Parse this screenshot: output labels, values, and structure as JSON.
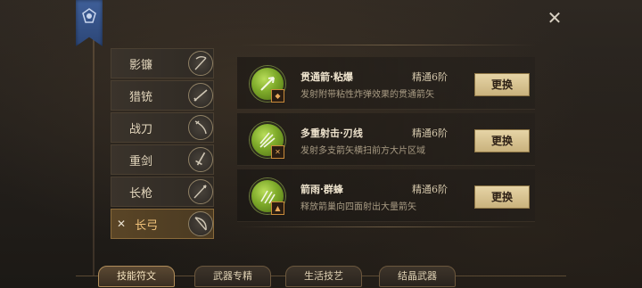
{
  "close_icon": "close-icon",
  "weapons": [
    {
      "label": "影镰",
      "icon": "scythe-icon",
      "selected": false
    },
    {
      "label": "猎铳",
      "icon": "musket-icon",
      "selected": false
    },
    {
      "label": "战刀",
      "icon": "sabre-icon",
      "selected": false
    },
    {
      "label": "重剑",
      "icon": "greatsword-icon",
      "selected": false
    },
    {
      "label": "长枪",
      "icon": "spear-icon",
      "selected": false
    },
    {
      "label": "长弓",
      "icon": "longbow-icon",
      "selected": true
    }
  ],
  "skills": [
    {
      "name": "贯通箭·粘爆",
      "rank": "精通6阶",
      "desc": "发射附带粘性炸弹效果的贯通箭矢",
      "button": "更换"
    },
    {
      "name": "多重射击·刃线",
      "rank": "精通6阶",
      "desc": "发射多支箭矢横扫前方大片区域",
      "button": "更换"
    },
    {
      "name": "箭雨·群蜂",
      "rank": "精通6阶",
      "desc": "释放箭巢向四面射出大量箭矢",
      "button": "更换"
    }
  ],
  "tabs": [
    {
      "label": "技能符文",
      "active": true
    },
    {
      "label": "武器专精",
      "active": false
    },
    {
      "label": "生活技艺",
      "active": false
    },
    {
      "label": "结晶武器",
      "active": false
    }
  ],
  "colors": {
    "accent_gold": "#f0c27a",
    "button_bg": "#e6d4a6",
    "skill_green": "#7eaa2a",
    "banner_blue": "#3f5f99"
  }
}
